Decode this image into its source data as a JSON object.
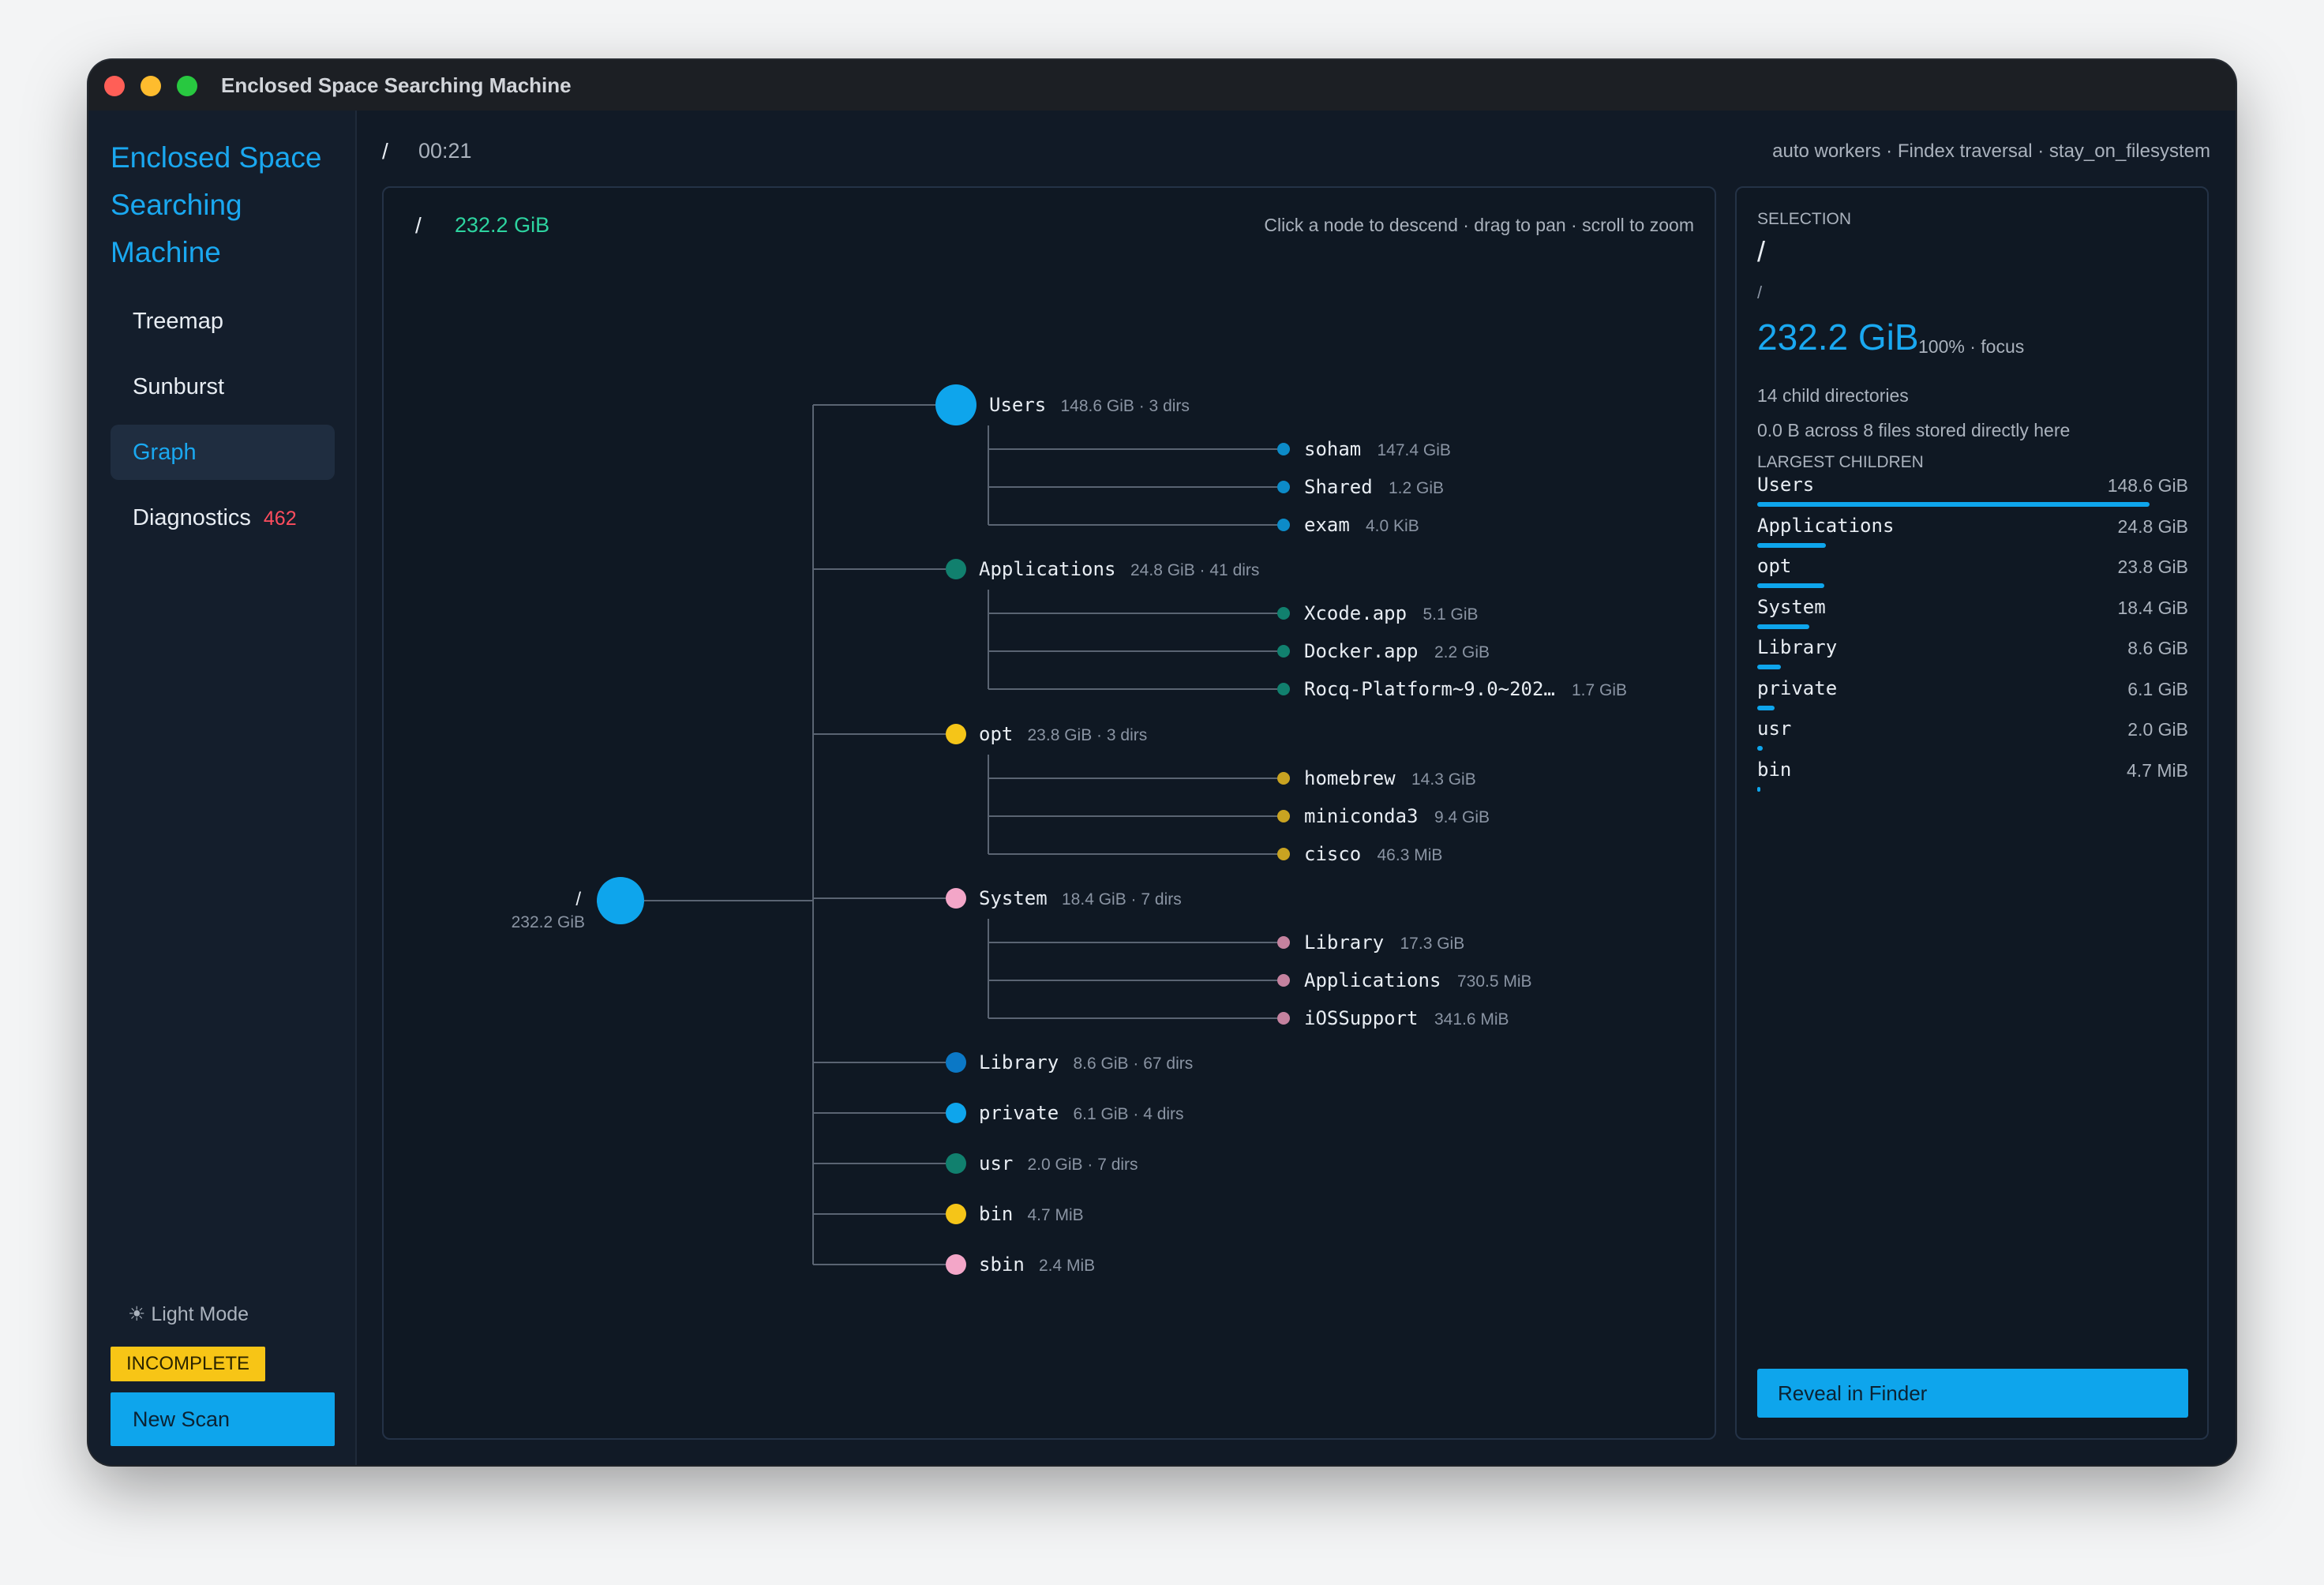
{
  "window": {
    "title": "Enclosed Space Searching Machine"
  },
  "sidebar": {
    "app_name": "Enclosed Space Searching Machine",
    "nav": [
      {
        "label": "Treemap",
        "active": false
      },
      {
        "label": "Sunburst",
        "active": false
      },
      {
        "label": "Graph",
        "active": true
      },
      {
        "label": "Diagnostics",
        "badge": "462",
        "active": false
      }
    ],
    "light_mode": "☀ Light Mode",
    "status": "INCOMPLETE",
    "new_scan": "New Scan"
  },
  "topbar": {
    "path": "/",
    "elapsed": "00:21",
    "info": "auto workers · Findex traversal · stay_on_filesystem"
  },
  "graph": {
    "path": "/",
    "total": "232.2 GiB",
    "hint": "Click a node to descend · drag to pan · scroll to zoom",
    "root": {
      "name": "/",
      "size": "232.2 GiB",
      "color": "#0ea5ec"
    },
    "children": [
      {
        "name": "Users",
        "meta": "148.6 GiB · 3 dirs",
        "color": "#0ea5ec",
        "big": true,
        "kids": [
          {
            "name": "soham",
            "size": "147.4 GiB",
            "color": "#0c8bc8"
          },
          {
            "name": "Shared",
            "size": "1.2 GiB",
            "color": "#0c8bc8"
          },
          {
            "name": "exam",
            "size": "4.0 KiB",
            "color": "#0c8bc8"
          }
        ]
      },
      {
        "name": "Applications",
        "meta": "24.8 GiB · 41 dirs",
        "color": "#11806e",
        "kids": [
          {
            "name": "Xcode.app",
            "size": "5.1 GiB",
            "color": "#11806e"
          },
          {
            "name": "Docker.app",
            "size": "2.2 GiB",
            "color": "#11806e"
          },
          {
            "name": "Rocq-Platform~9.0~202…",
            "size": "1.7 GiB",
            "color": "#11806e"
          }
        ]
      },
      {
        "name": "opt",
        "meta": "23.8 GiB · 3 dirs",
        "color": "#f5c518",
        "kids": [
          {
            "name": "homebrew",
            "size": "14.3 GiB",
            "color": "#c9a321"
          },
          {
            "name": "miniconda3",
            "size": "9.4 GiB",
            "color": "#c9a321"
          },
          {
            "name": "cisco",
            "size": "46.3 MiB",
            "color": "#c9a321"
          }
        ]
      },
      {
        "name": "System",
        "meta": "18.4 GiB · 7 dirs",
        "color": "#f3a6c8",
        "kids": [
          {
            "name": "Library",
            "size": "17.3 GiB",
            "color": "#c4829f"
          },
          {
            "name": "Applications",
            "size": "730.5 MiB",
            "color": "#c4829f"
          },
          {
            "name": "iOSSupport",
            "size": "341.6 MiB",
            "color": "#c4829f"
          }
        ]
      },
      {
        "name": "Library",
        "meta": "8.6 GiB · 67 dirs",
        "color": "#0b78c6",
        "kids": []
      },
      {
        "name": "private",
        "meta": "6.1 GiB · 4 dirs",
        "color": "#0ea5ec",
        "kids": []
      },
      {
        "name": "usr",
        "meta": "2.0 GiB · 7 dirs",
        "color": "#11806e",
        "kids": []
      },
      {
        "name": "bin",
        "meta": "4.7 MiB",
        "color": "#f5c518",
        "kids": []
      },
      {
        "name": "sbin",
        "meta": "2.4 MiB",
        "color": "#f3a6c8",
        "kids": []
      }
    ]
  },
  "selection": {
    "label": "SELECTION",
    "name": "/",
    "path": "/",
    "size": "232.2 GiB",
    "pct": "100% · focus",
    "child_dirs": "14 child directories",
    "direct_files": "0.0 B across 8 files stored directly here",
    "largest_label": "LARGEST CHILDREN",
    "children": [
      {
        "name": "Users",
        "size": "148.6 GiB",
        "fraction": 0.91
      },
      {
        "name": "Applications",
        "size": "24.8 GiB",
        "fraction": 0.16
      },
      {
        "name": "opt",
        "size": "23.8 GiB",
        "fraction": 0.155
      },
      {
        "name": "System",
        "size": "18.4 GiB",
        "fraction": 0.12
      },
      {
        "name": "Library",
        "size": "8.6 GiB",
        "fraction": 0.055
      },
      {
        "name": "private",
        "size": "6.1 GiB",
        "fraction": 0.04
      },
      {
        "name": "usr",
        "size": "2.0 GiB",
        "fraction": 0.013
      },
      {
        "name": "bin",
        "size": "4.7 MiB",
        "fraction": 0.004
      }
    ],
    "reveal": "Reveal in Finder"
  }
}
